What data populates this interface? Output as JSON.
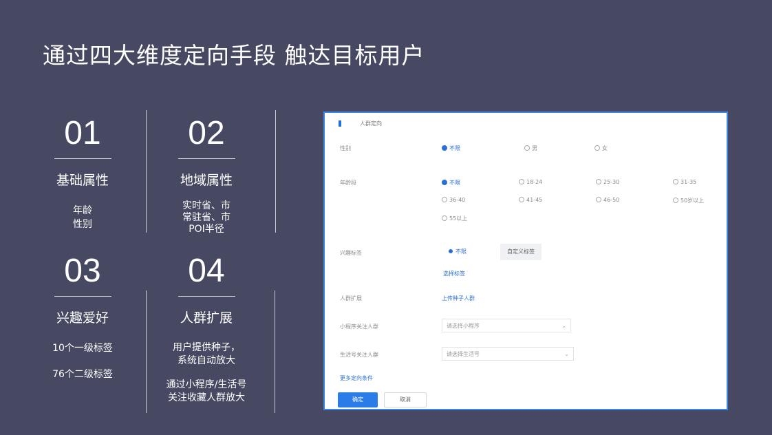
{
  "title": "通过四大维度定向手段 触达目标用户",
  "dimensions": [
    {
      "number": "01",
      "name": "基础属性",
      "items": [
        "年龄",
        "性别"
      ]
    },
    {
      "number": "02",
      "name": "地域属性",
      "items": [
        "实时省、市",
        "常驻省、市",
        "POI半径"
      ]
    },
    {
      "number": "03",
      "name": "兴趣爱好",
      "items": [
        "10个一级标签",
        "76个二级标签"
      ]
    },
    {
      "number": "04",
      "name": "人群扩展",
      "items": [
        "用户提供种子，",
        "系统自动放大",
        "通过小程序/生活号",
        "关注收藏人群放大"
      ]
    }
  ],
  "screenshot": {
    "header": "人群定向",
    "rows": [
      {
        "label": "性别",
        "options": [
          "不限",
          "男",
          "女"
        ],
        "selected": "不限"
      },
      {
        "label": "年龄段",
        "options": [
          "不限",
          "18-24",
          "25-30",
          "31-35",
          "36-40",
          "41-45",
          "46-50",
          "50岁以上",
          "55以上"
        ],
        "selected": "不限"
      },
      {
        "label": "兴趣标签",
        "segments": [
          "不限",
          "自定义标签"
        ],
        "selected": "不限",
        "link": "选择标签"
      },
      {
        "label": "人群扩展",
        "link": "上传种子人群"
      },
      {
        "label": "小程序关注人群",
        "placeholder": "请选择小程序"
      },
      {
        "label": "生活号关注人群",
        "placeholder": "请选择生活号"
      }
    ],
    "more_link": "更多定向条件",
    "confirm_label": "确定",
    "cancel_label": "取消"
  }
}
